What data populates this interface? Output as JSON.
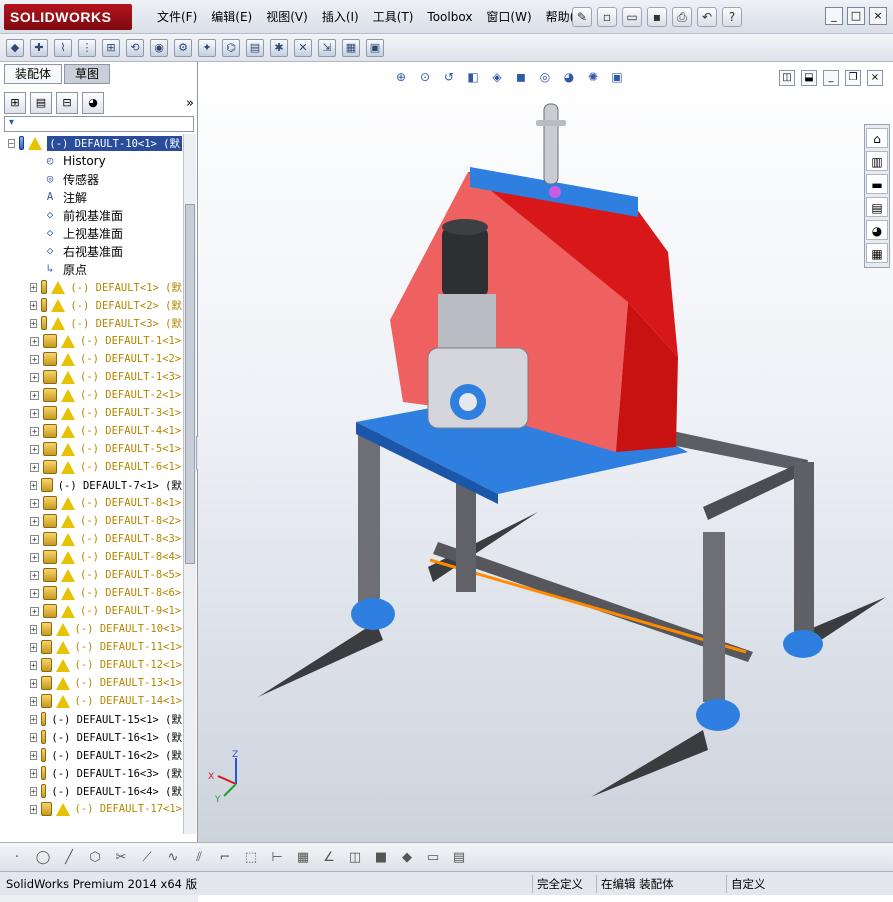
{
  "app": {
    "logo_text": "SOLIDWORKS"
  },
  "menu": [
    "文件(F)",
    "编辑(E)",
    "视图(V)",
    "插入(I)",
    "工具(T)",
    "Toolbox",
    "窗口(W)",
    "帮助(H)"
  ],
  "window_controls": [
    "_",
    "□",
    "×"
  ],
  "fm_tabs": {
    "assembly": "装配体",
    "sketch": "草图"
  },
  "filter_icon": "funnel-icon",
  "tree": {
    "root": "(-) DEFAULT-10<1> (默",
    "features": [
      "History",
      "传感器",
      "注解",
      "前视基准面",
      "上视基准面",
      "右视基准面",
      "原点"
    ],
    "components": [
      {
        "label": "(-) DEFAULT<1> (默",
        "warn": true
      },
      {
        "label": "(-) DEFAULT<2> (默",
        "warn": true
      },
      {
        "label": "(-) DEFAULT<3> (默",
        "warn": true
      },
      {
        "label": "(-) DEFAULT-1<1>",
        "warn": true
      },
      {
        "label": "(-) DEFAULT-1<2>",
        "warn": true
      },
      {
        "label": "(-) DEFAULT-1<3>",
        "warn": true
      },
      {
        "label": "(-) DEFAULT-2<1>",
        "warn": true
      },
      {
        "label": "(-) DEFAULT-3<1>",
        "warn": true
      },
      {
        "label": "(-) DEFAULT-4<1>",
        "warn": true
      },
      {
        "label": "(-) DEFAULT-5<1>",
        "warn": true
      },
      {
        "label": "(-) DEFAULT-6<1>",
        "warn": true
      },
      {
        "label": "(-) DEFAULT-7<1> (默",
        "warn": false
      },
      {
        "label": "(-) DEFAULT-8<1>",
        "warn": true
      },
      {
        "label": "(-) DEFAULT-8<2>",
        "warn": true
      },
      {
        "label": "(-) DEFAULT-8<3>",
        "warn": true
      },
      {
        "label": "(-) DEFAULT-8<4>",
        "warn": true
      },
      {
        "label": "(-) DEFAULT-8<5>",
        "warn": true
      },
      {
        "label": "(-) DEFAULT-8<6>",
        "warn": true
      },
      {
        "label": "(-) DEFAULT-9<1>",
        "warn": true
      },
      {
        "label": "(-) DEFAULT-10<1>",
        "warn": true
      },
      {
        "label": "(-) DEFAULT-11<1>",
        "warn": true
      },
      {
        "label": "(-) DEFAULT-12<1>",
        "warn": true
      },
      {
        "label": "(-) DEFAULT-13<1>",
        "warn": true
      },
      {
        "label": "(-) DEFAULT-14<1>",
        "warn": true
      },
      {
        "label": "(-) DEFAULT-15<1> (默",
        "warn": false
      },
      {
        "label": "(-) DEFAULT-16<1> (默",
        "warn": false
      },
      {
        "label": "(-) DEFAULT-16<2> (默",
        "warn": false
      },
      {
        "label": "(-) DEFAULT-16<3> (默",
        "warn": false
      },
      {
        "label": "(-) DEFAULT-16<4> (默",
        "warn": false
      },
      {
        "label": "(-) DEFAULT-17<1>",
        "warn": true
      }
    ]
  },
  "triad": {
    "x": "X",
    "y": "Y",
    "z": "Z"
  },
  "status": {
    "product": "SolidWorks Premium 2014 x64 版",
    "state": "完全定义",
    "mode": "在编辑 装配体",
    "units": "自定义"
  },
  "colors": {
    "housing": "#e83a3a",
    "plate": "#2f7fe0",
    "frame": "#6d6f75",
    "accent_line": "#ff8a00"
  }
}
